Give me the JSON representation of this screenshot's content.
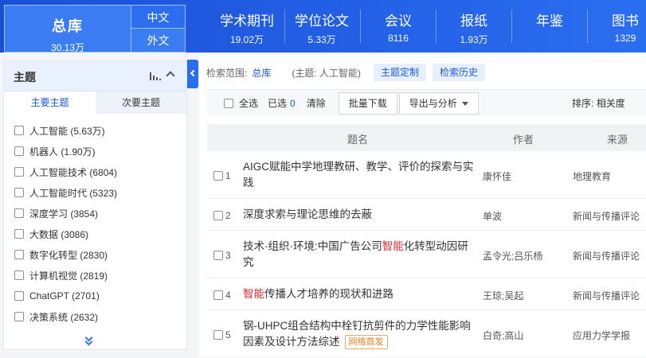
{
  "top_nav": {
    "zongku_label": "总库",
    "zongku_count": "30.13万",
    "lang_zh": "中文",
    "lang_en": "外文",
    "items": [
      {
        "label": "学术期刊",
        "count": "19.02万"
      },
      {
        "label": "学位论文",
        "count": "5.33万"
      },
      {
        "label": "会议",
        "count": "8116"
      },
      {
        "label": "报纸",
        "count": "1.93万"
      },
      {
        "label": "年鉴",
        "count": ""
      },
      {
        "label": "图书",
        "count": "1329"
      }
    ]
  },
  "sidebar": {
    "title": "主题",
    "tab_primary": "主要主题",
    "tab_secondary": "次要主题",
    "items": [
      {
        "label": "人工智能 (5.63万)"
      },
      {
        "label": "机器人 (1.90万)"
      },
      {
        "label": "人工智能技术 (6804)"
      },
      {
        "label": "人工智能时代 (5323)"
      },
      {
        "label": "深度学习 (3854)"
      },
      {
        "label": "大数据 (3086)"
      },
      {
        "label": "数字化转型 (2830)"
      },
      {
        "label": "计算机视觉 (2819)"
      },
      {
        "label": "ChatGPT (2701)"
      },
      {
        "label": "决策系统 (2632)"
      }
    ]
  },
  "scope": {
    "label": "检索范围:",
    "value": "总库",
    "query": "(主题: 人工智能)",
    "btn_custom": "主题定制",
    "btn_history": "检索历史"
  },
  "toolbar": {
    "select_all": "全选",
    "selected_label": "已选",
    "selected_count": "0",
    "clear": "清除",
    "batch_download": "批量下载",
    "export": "导出与分析",
    "sort_label": "排序:",
    "sort_value": "相关度"
  },
  "table": {
    "headers": {
      "title": "题名",
      "author": "作者",
      "source": "来源"
    },
    "rows": [
      {
        "num": "1",
        "title_pre": "AIGC赋能中学地理教研、教学、评价的探索与实践",
        "hl": "",
        "title_post": "",
        "author": "康怀佳",
        "source": "地理教育",
        "tag": ""
      },
      {
        "num": "2",
        "title_pre": "深度求索与理论思维的去蔽",
        "hl": "",
        "title_post": "",
        "author": "单波",
        "source": "新闻与传播评论",
        "tag": ""
      },
      {
        "num": "3",
        "title_pre": "技术·组织·环境:中国广告公司",
        "hl": "智能",
        "title_post": "化转型动因研究",
        "author": "孟令光;吕乐杨",
        "source": "新闻与传播评论",
        "tag": ""
      },
      {
        "num": "4",
        "title_pre": "",
        "hl": "智能",
        "title_post": "传播人才培养的现状和进路",
        "author": "王琼;吴起",
        "source": "新闻与传播评论",
        "tag": ""
      },
      {
        "num": "5",
        "title_pre": "钢-UHPC组合结构中栓钉抗剪件的力学性能影响因素及设计方法综述",
        "hl": "",
        "title_post": "",
        "author": "白奇;高山",
        "source": "应用力学学报",
        "tag": "网络首发"
      }
    ]
  },
  "colors": {
    "brand_blue": "#1b4fd8",
    "link_blue": "#1a5ad9",
    "highlight_red": "#e0292d",
    "tag_orange": "#f07a1e"
  }
}
